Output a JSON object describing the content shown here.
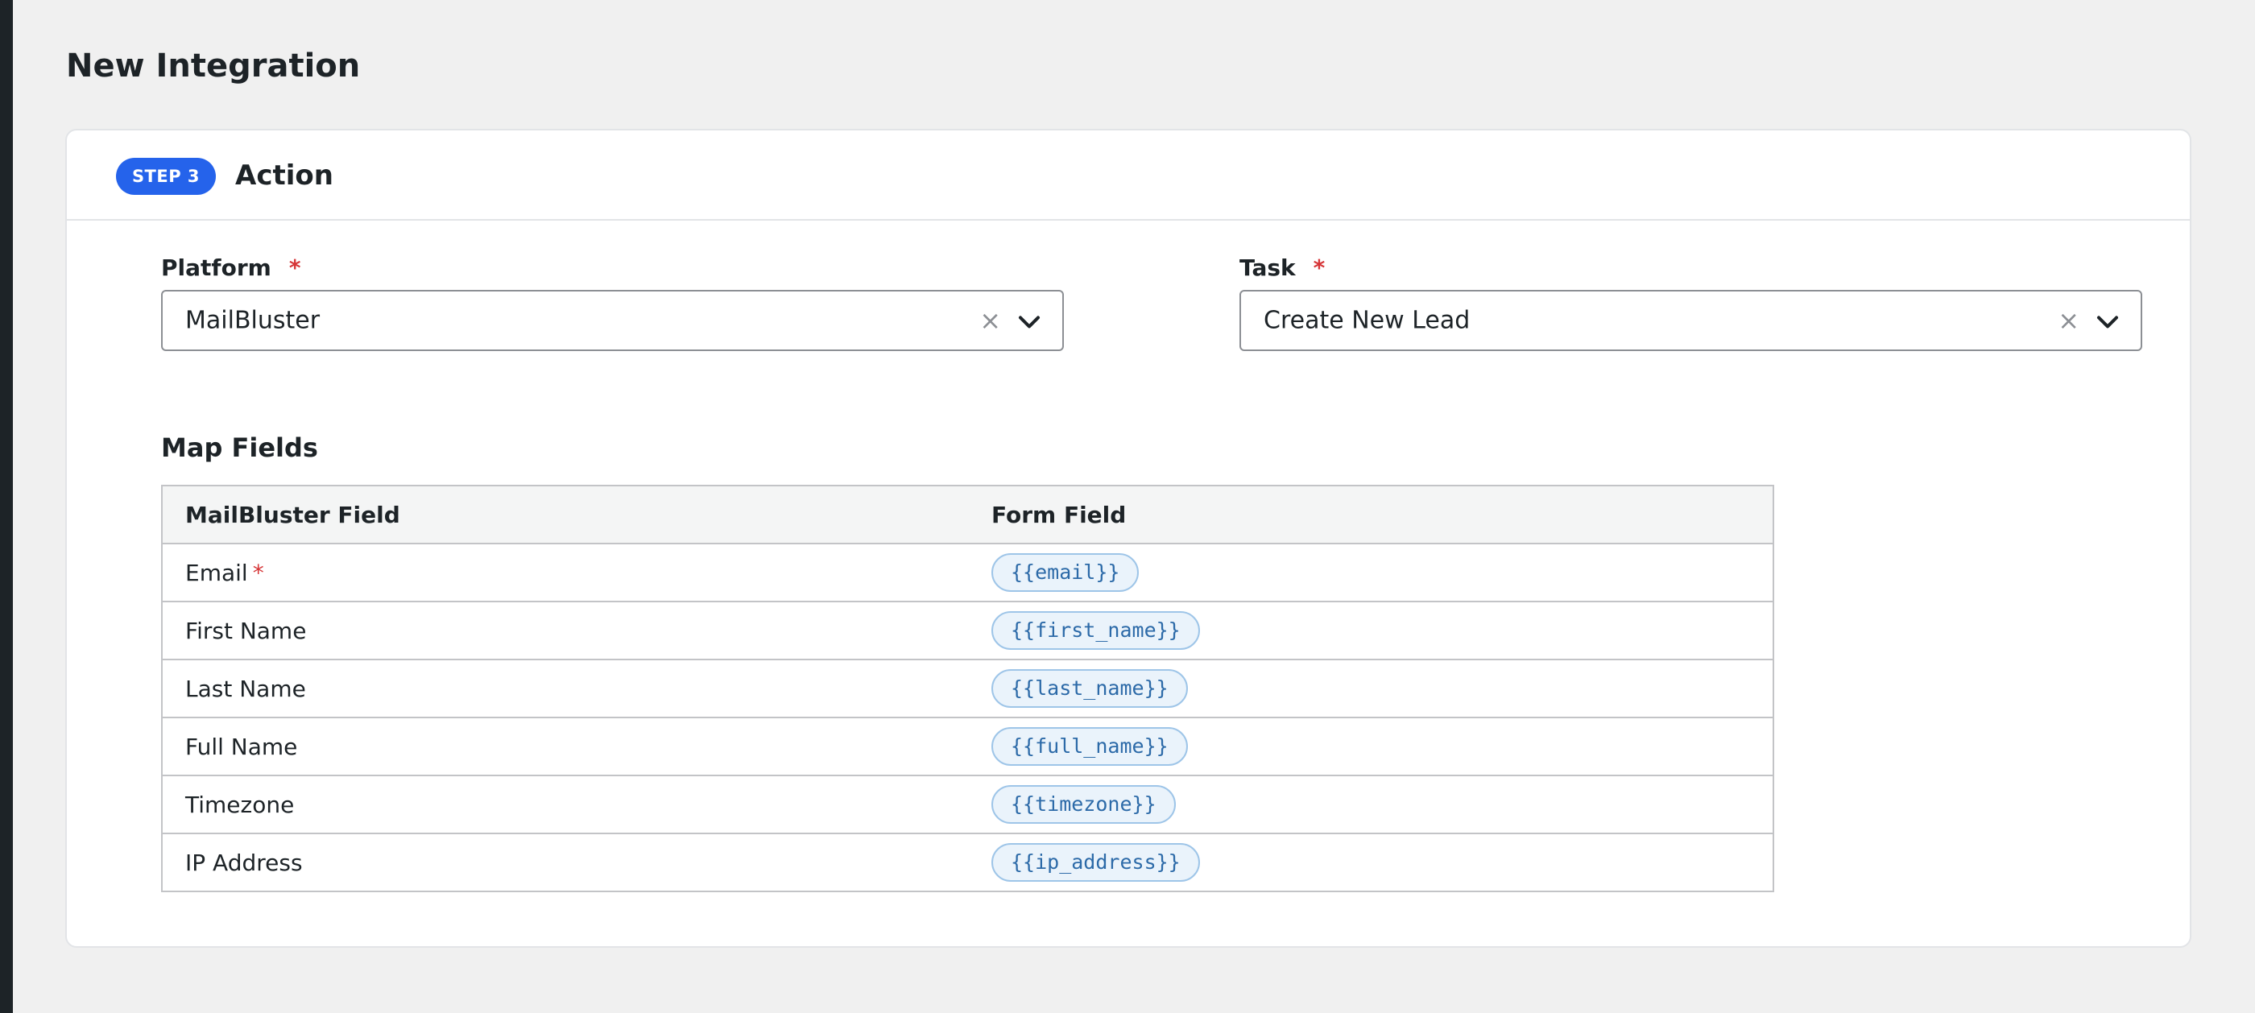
{
  "page": {
    "title": "New Integration"
  },
  "step": {
    "badge": "STEP 3",
    "title": "Action"
  },
  "platform": {
    "label": "Platform",
    "required_mark": "*",
    "value": "MailBluster",
    "clear_icon": "×"
  },
  "task": {
    "label": "Task",
    "required_mark": "*",
    "value": "Create New Lead",
    "clear_icon": "×"
  },
  "map_fields": {
    "title": "Map Fields",
    "headers": [
      "MailBluster Field",
      "Form Field"
    ],
    "rows": [
      {
        "field": "Email",
        "required": true,
        "required_mark": "*",
        "token": "{{email}}"
      },
      {
        "field": "First Name",
        "required": false,
        "token": "{{first_name}}"
      },
      {
        "field": "Last Name",
        "required": false,
        "token": "{{last_name}}"
      },
      {
        "field": "Full Name",
        "required": false,
        "token": "{{full_name}}"
      },
      {
        "field": "Timezone",
        "required": false,
        "token": "{{timezone}}"
      },
      {
        "field": "IP Address",
        "required": false,
        "token": "{{ip_address}}"
      }
    ]
  },
  "colors": {
    "accent": "#2563eb",
    "required": "#d63638",
    "token_text": "#2c6aa8",
    "token_bg": "#eaf3fb"
  },
  "icons": {
    "clear": "close-icon",
    "dropdown": "chevron-down-icon"
  }
}
